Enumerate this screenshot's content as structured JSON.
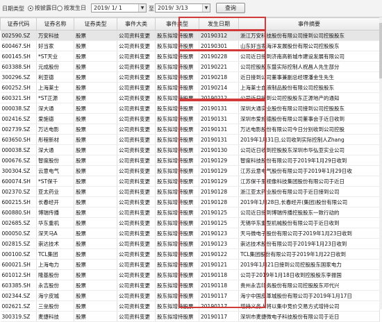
{
  "toolbar": {
    "date_type_label": "日期类型",
    "radio_announce": "按披露日",
    "radio_occur": "按发生日",
    "start_date": "2019/ 1/ 1",
    "to_label": "至",
    "end_date": "2019/ 3/13",
    "query_label": "查询"
  },
  "columns": [
    "证券代码",
    "证券名称",
    "证券类型",
    "事件大类",
    "事件类型",
    "发生日期",
    "事件摘要"
  ],
  "rows": [
    [
      "002590.SZ",
      "万安科技",
      "股票",
      "公司资料变更",
      "股东拟增持股票",
      "20190312",
      "浙江万安科技股份有限公司接到公司控股股东"
    ],
    [
      "600467.SH",
      "好当家",
      "股票",
      "公司资料变更",
      "股东拟增持股票",
      "20190301",
      "山东好当家海洋发展股份有限公司控股股东"
    ],
    [
      "600145.SH",
      "*ST天业",
      "股票",
      "公司资料变更",
      "股东拟增持股票",
      "20190228",
      "公司近日接到济南高新城市建设发展有限公司"
    ],
    [
      "603388.SH",
      "元成股份",
      "股票",
      "公司资料变更",
      "股东拟增持股票",
      "20190221",
      "公司控股股东暨实际控制人祝昌人先生部分"
    ],
    [
      "300296.SZ",
      "利亚德",
      "股票",
      "公司资料变更",
      "股东拟增持股票",
      "20190218",
      "近日接到公司董事兼副总经理潘金生先生"
    ],
    [
      "600252.SH",
      "上海莱士",
      "股票",
      "公司资料变更",
      "股东拟增持股票",
      "20190214",
      "上海莱士血液制品股份有限公司控股股东"
    ],
    [
      "600321.SH",
      "*ST正源",
      "股票",
      "公司资料变更",
      "股东拟增持股票",
      "20190212",
      "公司近日接到公司控股股东正源地产的通知"
    ],
    [
      "000038.SZ",
      "深大通",
      "股票",
      "公司资料变更",
      "股东拟增持股票",
      "20190131",
      "深圳大通实业股份有限公司接到公司控股股东"
    ],
    [
      "002416.SZ",
      "爱施德",
      "股票",
      "公司资料变更",
      "股东拟增持股票",
      "20190131",
      "深圳市爱施德股份有限公司董事会于近日收到"
    ],
    [
      "002739.SZ",
      "万达电影",
      "股票",
      "公司资料变更",
      "股东拟增持股票",
      "20190131",
      "万达电影股份有限公司今日分别收到公司控股"
    ],
    [
      "603650.SH",
      "彤程新材",
      "股票",
      "公司资料变更",
      "股东拟增持股票",
      "20190131",
      "2019年1月31日,公司收到实际控制人Zhang"
    ],
    [
      "000038.SZ",
      "深大通",
      "股票",
      "公司资料变更",
      "股东拟增持股票",
      "20190130",
      "公司近日收到控股股东深圳市华弘亚实业公司"
    ],
    [
      "000676.SZ",
      "智度股份",
      "股票",
      "公司资料变更",
      "股东拟增持股票",
      "20190129",
      "智度科技股份有限公司于2019年1月29日收到"
    ],
    [
      "300304.SZ",
      "云意电气",
      "股票",
      "公司资料变更",
      "股东拟增持股票",
      "20190129",
      "江苏云意电气股份有限公司于2019年1月29日收"
    ],
    [
      "600074.SH",
      "*ST保千",
      "股票",
      "公司资料变更",
      "股东拟增持股票",
      "20190129",
      "江苏保千里视像科技集团股份有限公司于近日"
    ],
    [
      "002370.SZ",
      "亚太药业",
      "股票",
      "公司资料变更",
      "股东拟增持股票",
      "20190128",
      "浙江亚太药业股份有限公司于近日接到公司"
    ],
    [
      "600215.SH",
      "长春经开",
      "股票",
      "公司资料变更",
      "股东拟增持股票",
      "20190128",
      "2019年1月28日,长春经开(集团)股份有限公司"
    ],
    [
      "600880.SH",
      "博瑞传播",
      "股票",
      "公司资料变更",
      "股东拟增持股票",
      "20190125",
      "公司近日接到博瑞传播控股股东一致行动的"
    ],
    [
      "002685.SZ",
      "华东重机",
      "股票",
      "公司资料变更",
      "股东拟增持股票",
      "20190125",
      "无锡华东重型机械股份有限公司于近日收到"
    ],
    [
      "000050.SZ",
      "深天马A",
      "股票",
      "公司资料变更",
      "股东拟增持股票",
      "20190123",
      "天马微电子股份有限公司于2019年1月23日收到"
    ],
    [
      "002815.SZ",
      "崇达技术",
      "股票",
      "公司资料变更",
      "股东拟增持股票",
      "20190123",
      "崇达技术股份有限公司于2019年1月23日收到"
    ],
    [
      "000100.SZ",
      "TCL集团",
      "股票",
      "公司资料变更",
      "股东拟增持股票",
      "20190122",
      "TCL集团股份有限公司于2019年1月22日收到"
    ],
    [
      "600021.SH",
      "上海电力",
      "股票",
      "公司资料变更",
      "股东拟增持股票",
      "20190121",
      "2019年1月21日接到公司控股股东国家电力"
    ],
    [
      "601012.SH",
      "隆基股份",
      "股票",
      "公司资料变更",
      "股东拟增持股票",
      "20190118",
      "公司于2019年1月18日收到控股股东李振国"
    ],
    [
      "603385.SH",
      "永吉股份",
      "股票",
      "公司资料变更",
      "股东拟增持股票",
      "20190118",
      "贵州永吉印务股份有限公司控股股东邓代兴"
    ],
    [
      "002344.SZ",
      "海宁皮城",
      "股票",
      "公司资料变更",
      "股东拟增持股票",
      "20190117",
      "海宁中国皮革城股份有限公司于2019年1月17日"
    ],
    [
      "002621.SZ",
      "三垒股份",
      "股票",
      "公司资料变更",
      "股东拟增持股票",
      "20190117",
      "增持义务人将以集中竞价交易方式增持公司"
    ],
    [
      "300319.SZ",
      "麦捷科技",
      "股票",
      "公司资料变更",
      "股东拟增持股票",
      "20190117",
      "深圳市麦捷微电子科技股份有限公司于近日"
    ]
  ]
}
